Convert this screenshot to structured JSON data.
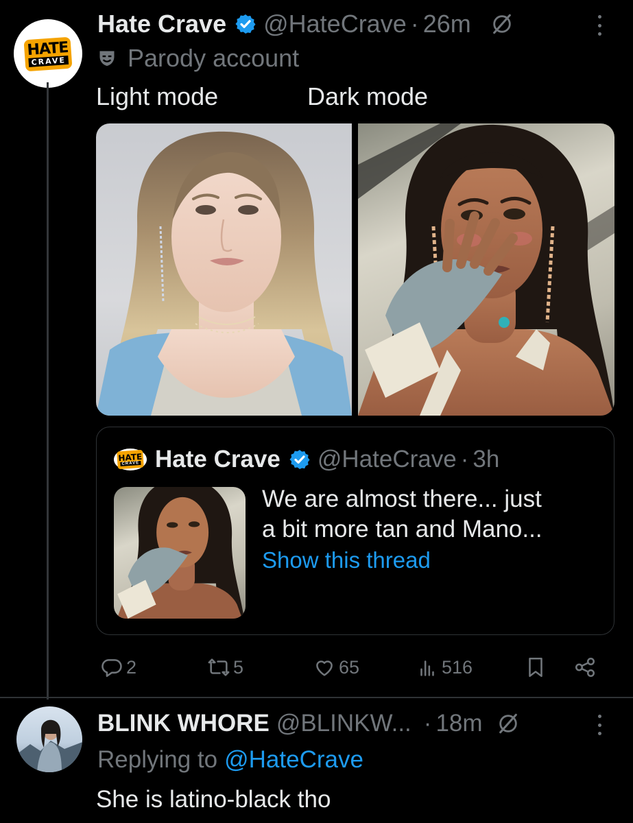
{
  "main_tweet": {
    "author_name": "Hate Crave",
    "handle": "@HateCrave",
    "separator": "·",
    "time": "26m",
    "account_label": "Parody account",
    "avatar_logo_top": "HATE",
    "avatar_logo_bottom": "CRAVE",
    "text_left": "Light mode",
    "text_right": "Dark mode",
    "image_left_icon": "woman-portrait-light-image",
    "image_right_icon": "woman-portrait-dark-image"
  },
  "quoted_tweet": {
    "author_name": "Hate Crave",
    "handle": "@HateCrave",
    "separator": "·",
    "time": "3h",
    "text_line1": "We are almost there... just",
    "text_line2": "a bit more tan and Mano...",
    "show_thread": "Show this thread"
  },
  "actions": {
    "replies": "2",
    "reposts": "5",
    "likes": "65",
    "views": "516"
  },
  "reply": {
    "author_name": "BLINK WHORE",
    "handle": "@BLINKW...",
    "separator": "·",
    "time": "18m",
    "replying_prefix": "Replying to",
    "replying_handle": "@HateCrave",
    "text": "She is latino-black tho"
  },
  "colors": {
    "background": "#000000",
    "text": "#e7e9ea",
    "muted": "#71767b",
    "link": "#1d9bf0",
    "verified": "#1d9bf0",
    "brand": "#f5a300"
  }
}
